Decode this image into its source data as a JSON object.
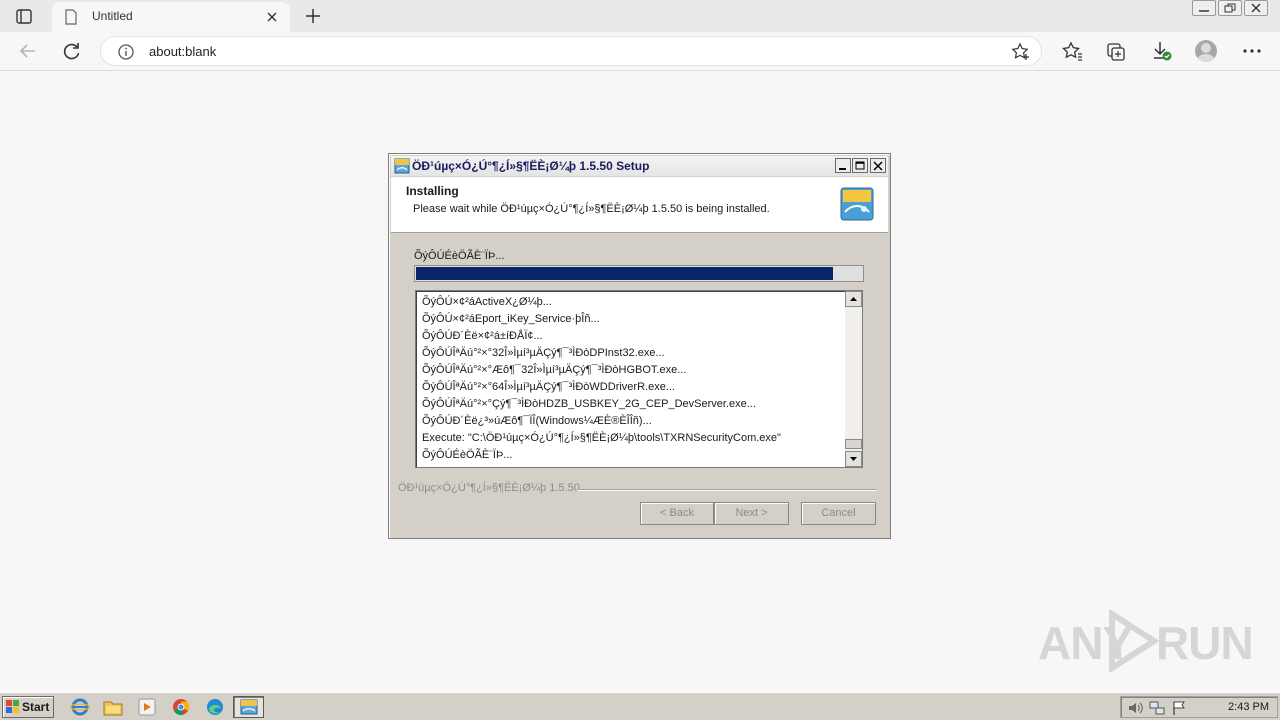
{
  "browser": {
    "tab_title": "Untitled",
    "address": "about:blank"
  },
  "dialog": {
    "title": "ÖÐ¹úµç×Ó¿Ú°¶¿Í»§¶ËÈ¡Ø¼þ 1.5.50 Setup",
    "header_title": "Installing",
    "header_subtitle": "Please wait while ÖÐ¹úµç×Ó¿Ú°¶¿Í»§¶ËÈ¡Ø¼þ 1.5.50 is being installed.",
    "status": "ÕýÔÚÉèÖÃÈ¨ÏÞ...",
    "progress": 0.93,
    "log": [
      "ÕýÔÚ×¢²áActiveX¿Ø¼þ...",
      "ÕýÔÚ×¢²áEport_iKey_Service·þÎñ...",
      "ÕýÔÚÐ´Èë×¢²á±íÐÅÏ¢...",
      "ÕýÔÚÎªÄú°²×°32Î»Ìµí³µÄÇý¶¯³ÌÐòDPInst32.exe...",
      "ÕýÔÚÎªÄú°²×°Æô¶¯32Î»Ìµí³µÄÇý¶¯³ÌÐòHGBOT.exe...",
      "ÕýÔÚÎªÄú°²×°64Î»Ìµí³µÄÇý¶¯³ÌÐòWDDriverR.exe...",
      "ÕýÔÚÎªÄú°²×°Çý¶¯³ÌÐòHDZB_USBKEY_2G_CEP_DevServer.exe...",
      "ÕýÔÚÐ´Èë¿³»úÆô¶¯ÏÎ(Windows¼ÆÈ®ÈÎÎñ)...",
      "Execute: \"C:\\ÖÐ¹úµç×Ó¿Ú°¶¿Í»§¶ËÈ¡Ø¼þ\\tools\\TXRNSecurityCom.exe\"",
      "ÕýÔÚÉèÖÃÈ¨ÏÞ..."
    ],
    "branding": "ÖÐ¹úµç×Ó¿Ú°¶¿Í»§¶ËÈ¡Ø¼þ 1.5.50",
    "back_label": "< Back",
    "next_label": "Next >",
    "cancel_label": "Cancel"
  },
  "taskbar": {
    "start_label": "Start",
    "clock": "2:43 PM"
  },
  "watermark": {
    "left": "ANY",
    "right": "RUN"
  }
}
